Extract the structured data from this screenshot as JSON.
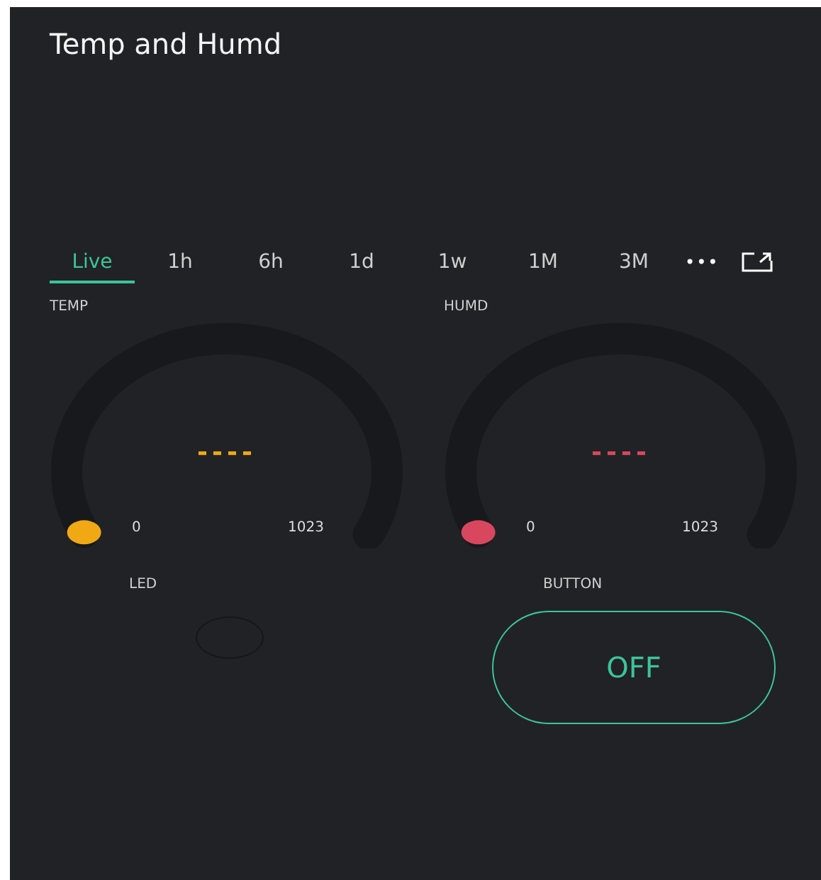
{
  "title": "Temp and Humd",
  "tabs": [
    {
      "label": "Live",
      "selected": true
    },
    {
      "label": "1h",
      "selected": false
    },
    {
      "label": "6h",
      "selected": false
    },
    {
      "label": "1d",
      "selected": false
    },
    {
      "label": "1w",
      "selected": false
    },
    {
      "label": "1M",
      "selected": false
    },
    {
      "label": "3M",
      "selected": false
    }
  ],
  "more_label": "•••",
  "gauges": [
    {
      "label": "TEMP",
      "value": "----",
      "color": "#f0a915",
      "level": 0,
      "min": "0",
      "max": "1023"
    },
    {
      "label": "HUMD",
      "value": "----",
      "color": "#d9475f",
      "level": 0,
      "min": "0",
      "max": "1023"
    }
  ],
  "led": {
    "label": "LED",
    "on": false
  },
  "button": {
    "label": "BUTTON",
    "text": "OFF",
    "on": false
  }
}
